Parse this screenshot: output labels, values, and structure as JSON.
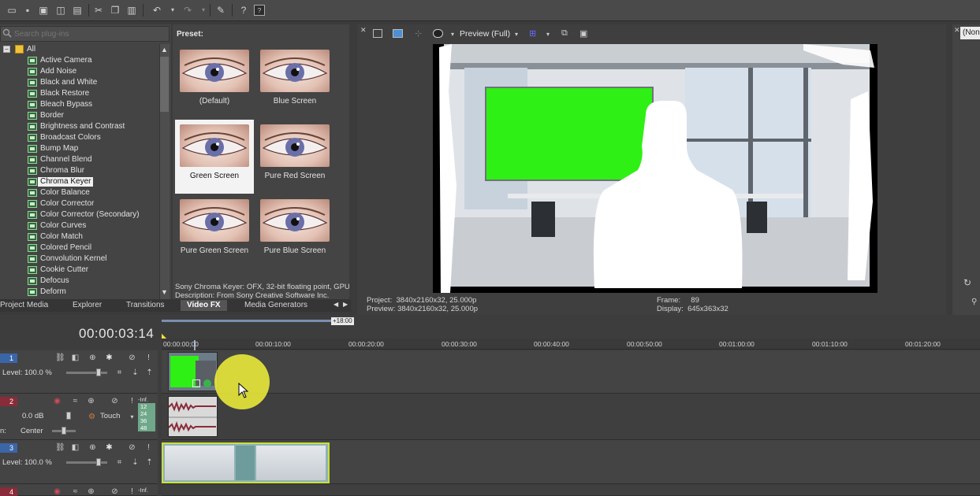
{
  "toolbar": {
    "icons": [
      "open-folder-icon",
      "save-icon",
      "save-as-icon",
      "render-icon",
      "properties-icon",
      "cut-icon",
      "copy-icon",
      "paste-icon",
      "undo-icon",
      "redo-icon",
      "paint-brush-icon",
      "help-icon",
      "whats-this-icon"
    ]
  },
  "plugins": {
    "search_placeholder": "Search plug-ins",
    "root": "All",
    "items": [
      "Active Camera",
      "Add Noise",
      "Black and White",
      "Black Restore",
      "Bleach Bypass",
      "Border",
      "Brightness and Contrast",
      "Broadcast Colors",
      "Bump Map",
      "Channel Blend",
      "Chroma Blur",
      "Chroma Keyer",
      "Color Balance",
      "Color Corrector",
      "Color Corrector (Secondary)",
      "Color Curves",
      "Color Match",
      "Colored Pencil",
      "Convolution Kernel",
      "Cookie Cutter",
      "Defocus",
      "Deform"
    ],
    "selected": "Chroma Keyer"
  },
  "presets": {
    "title": "Preset:",
    "items": [
      "(Default)",
      "Blue Screen",
      "Green Screen",
      "Pure Red Screen",
      "Pure Green Screen",
      "Pure Blue Screen"
    ],
    "selected": "Green Screen",
    "description_line1": "Sony Chroma Keyer: OFX, 32-bit floating point, GPU",
    "description_line2": "Description: From Sony Creative Software Inc."
  },
  "tabs": {
    "items": [
      "Project Media",
      "Explorer",
      "Transitions",
      "Video FX",
      "Media Generators"
    ],
    "active": "Video FX"
  },
  "preview": {
    "mode_label": "Preview (Full)",
    "project_label": "Project:",
    "project_value": "3840x2160x32, 25.000p",
    "preview_label": "Preview:",
    "preview_value": "3840x2160x32, 25.000p",
    "frame_label": "Frame:",
    "frame_value": "89",
    "display_label": "Display:",
    "display_value": "645x363x32"
  },
  "right_panel": {
    "none_label": "(None"
  },
  "timeline": {
    "timecode": "00:00:03:14",
    "region_badge": "+18:00",
    "ruler_labels": [
      "00:00:00;00",
      "00:00:10:00",
      "00:00:20:00",
      "00:00:30:00",
      "00:00:40:00",
      "00:00:50:00",
      "00:01:00:00",
      "00:01:10:00",
      "00:01:20:00"
    ],
    "tracks": [
      {
        "number": "1",
        "kind": "video",
        "level_label": "Level: 100.0 %"
      },
      {
        "number": "2",
        "kind": "audio",
        "volume": "0.0 dB",
        "pan_label": "Center",
        "pan_prefix": "n:",
        "automation": "Touch",
        "meter": [
          "-Inf.",
          "12",
          "24",
          "36",
          "48"
        ]
      },
      {
        "number": "3",
        "kind": "video",
        "level_label": "Level: 100.0 %"
      },
      {
        "number": "4",
        "kind": "audio",
        "meter": [
          "-Inf."
        ]
      }
    ]
  },
  "colors": {
    "accent_green_screen": "#2ef014",
    "cursor_highlight": "#f2f238",
    "video_track": "#3a66a8",
    "audio_track": "#8a2b3a"
  }
}
